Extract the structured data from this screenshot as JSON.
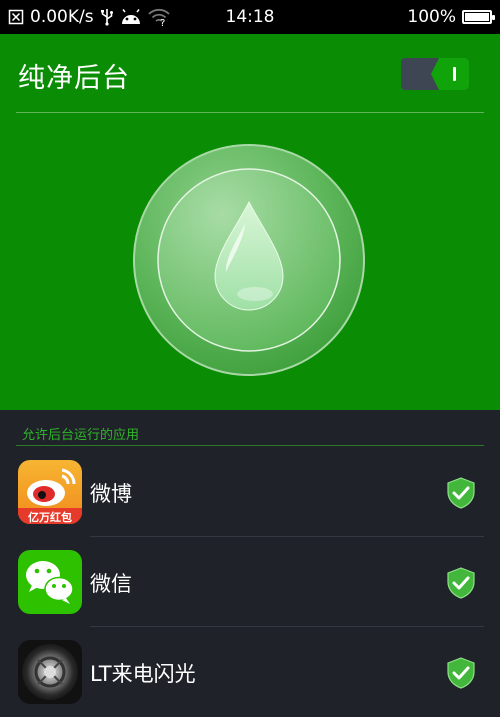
{
  "status_bar": {
    "network_speed": "0.00K/s",
    "time": "14:18",
    "battery_percent": "100%",
    "icons": [
      "no-sim-icon",
      "usb-icon",
      "android-debug-icon",
      "wifi-unknown-icon",
      "battery-icon"
    ]
  },
  "header": {
    "title": "纯净后台",
    "toggle_state": "on",
    "accent_color": "#0b8c05"
  },
  "section": {
    "label": "允许后台运行的应用"
  },
  "apps": [
    {
      "name": "微博",
      "icon": "weibo-icon",
      "allowed": true
    },
    {
      "name": "微信",
      "icon": "wechat-icon",
      "allowed": true
    },
    {
      "name": "LT来电闪光",
      "icon": "lt-flash-icon",
      "allowed": true
    }
  ],
  "weibo_icon_banner": "亿万红包"
}
